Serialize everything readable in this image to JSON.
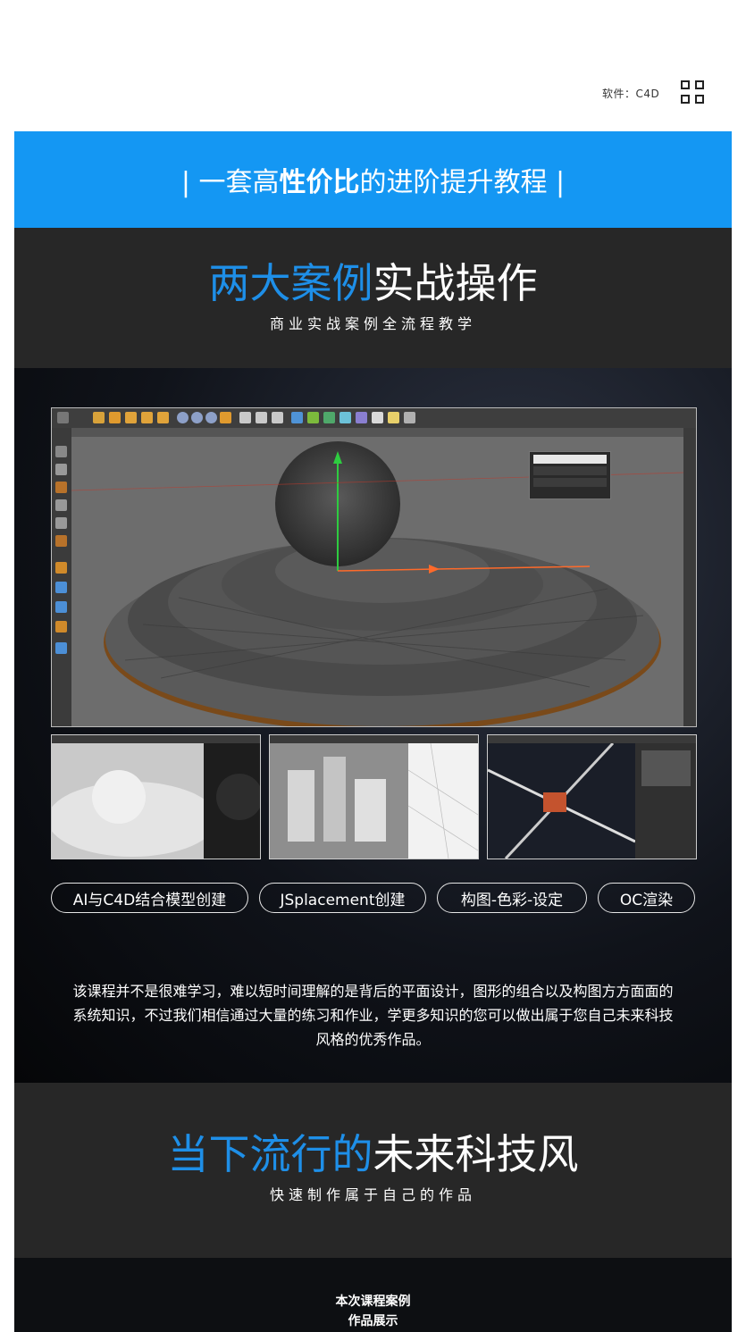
{
  "header": {
    "software_label": "软件：C4D",
    "menu_icon": "grid-menu-icon"
  },
  "banner": {
    "prefix": "| 一套高",
    "bold": "性价比",
    "suffix": "的进阶提升教程 |",
    "bg_color": "#1497f3"
  },
  "section1": {
    "title_blue": "两大案例",
    "title_white": "实战操作",
    "subtitle": "商业实战案例全流程教学"
  },
  "showcase": {
    "tags": [
      "AI与C4D结合模型创建",
      "JSplacement创建",
      "构图-色彩-设定",
      "OC渲染"
    ],
    "description": "该课程并不是很难学习，难以短时间理解的是背后的平面设计，图形的组合以及构图方方面面的系统知识，不过我们相信通过大量的练习和作业，学更多知识的您可以做出属于您自己未来科技风格的优秀作品。"
  },
  "section2": {
    "title_blue": "当下流行的",
    "title_white": "未来科技风",
    "subtitle": "快速制作属于自己的作品"
  },
  "section3": {
    "line1": "本次课程案例",
    "line2": "作品展示"
  },
  "colors": {
    "accent_blue": "#1e8fe8",
    "dark_section": "#272727"
  }
}
